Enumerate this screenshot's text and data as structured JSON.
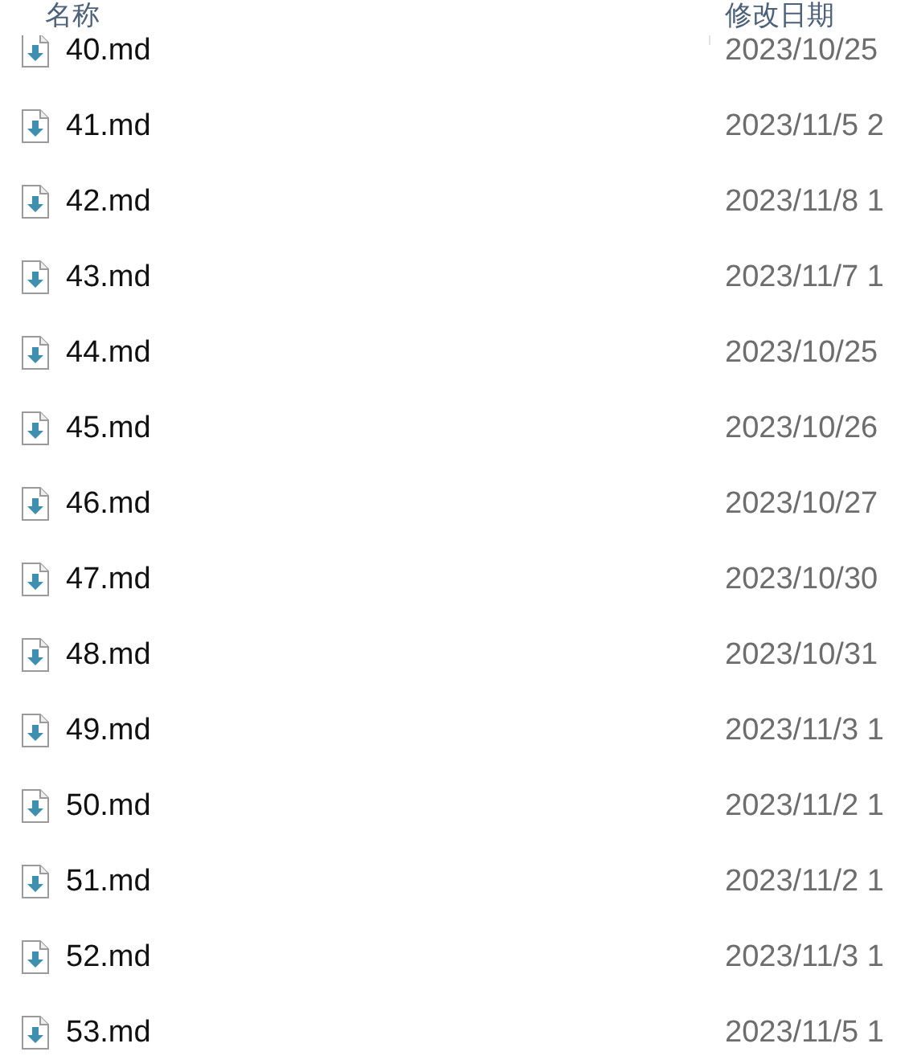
{
  "columns": [
    {
      "label": "名称"
    },
    {
      "label": "修改日期"
    }
  ],
  "rows": [
    {
      "name": "40.md",
      "date": "2023/10/25"
    },
    {
      "name": "41.md",
      "date": "2023/11/5 2"
    },
    {
      "name": "42.md",
      "date": "2023/11/8 1"
    },
    {
      "name": "43.md",
      "date": "2023/11/7 1"
    },
    {
      "name": "44.md",
      "date": "2023/10/25"
    },
    {
      "name": "45.md",
      "date": "2023/10/26"
    },
    {
      "name": "46.md",
      "date": "2023/10/27"
    },
    {
      "name": "47.md",
      "date": "2023/10/30"
    },
    {
      "name": "48.md",
      "date": "2023/10/31"
    },
    {
      "name": "49.md",
      "date": "2023/11/3 1"
    },
    {
      "name": "50.md",
      "date": "2023/11/2 1"
    },
    {
      "name": "51.md",
      "date": "2023/11/2 1"
    },
    {
      "name": "52.md",
      "date": "2023/11/3 1"
    },
    {
      "name": "53.md",
      "date": "2023/11/5 1"
    }
  ]
}
